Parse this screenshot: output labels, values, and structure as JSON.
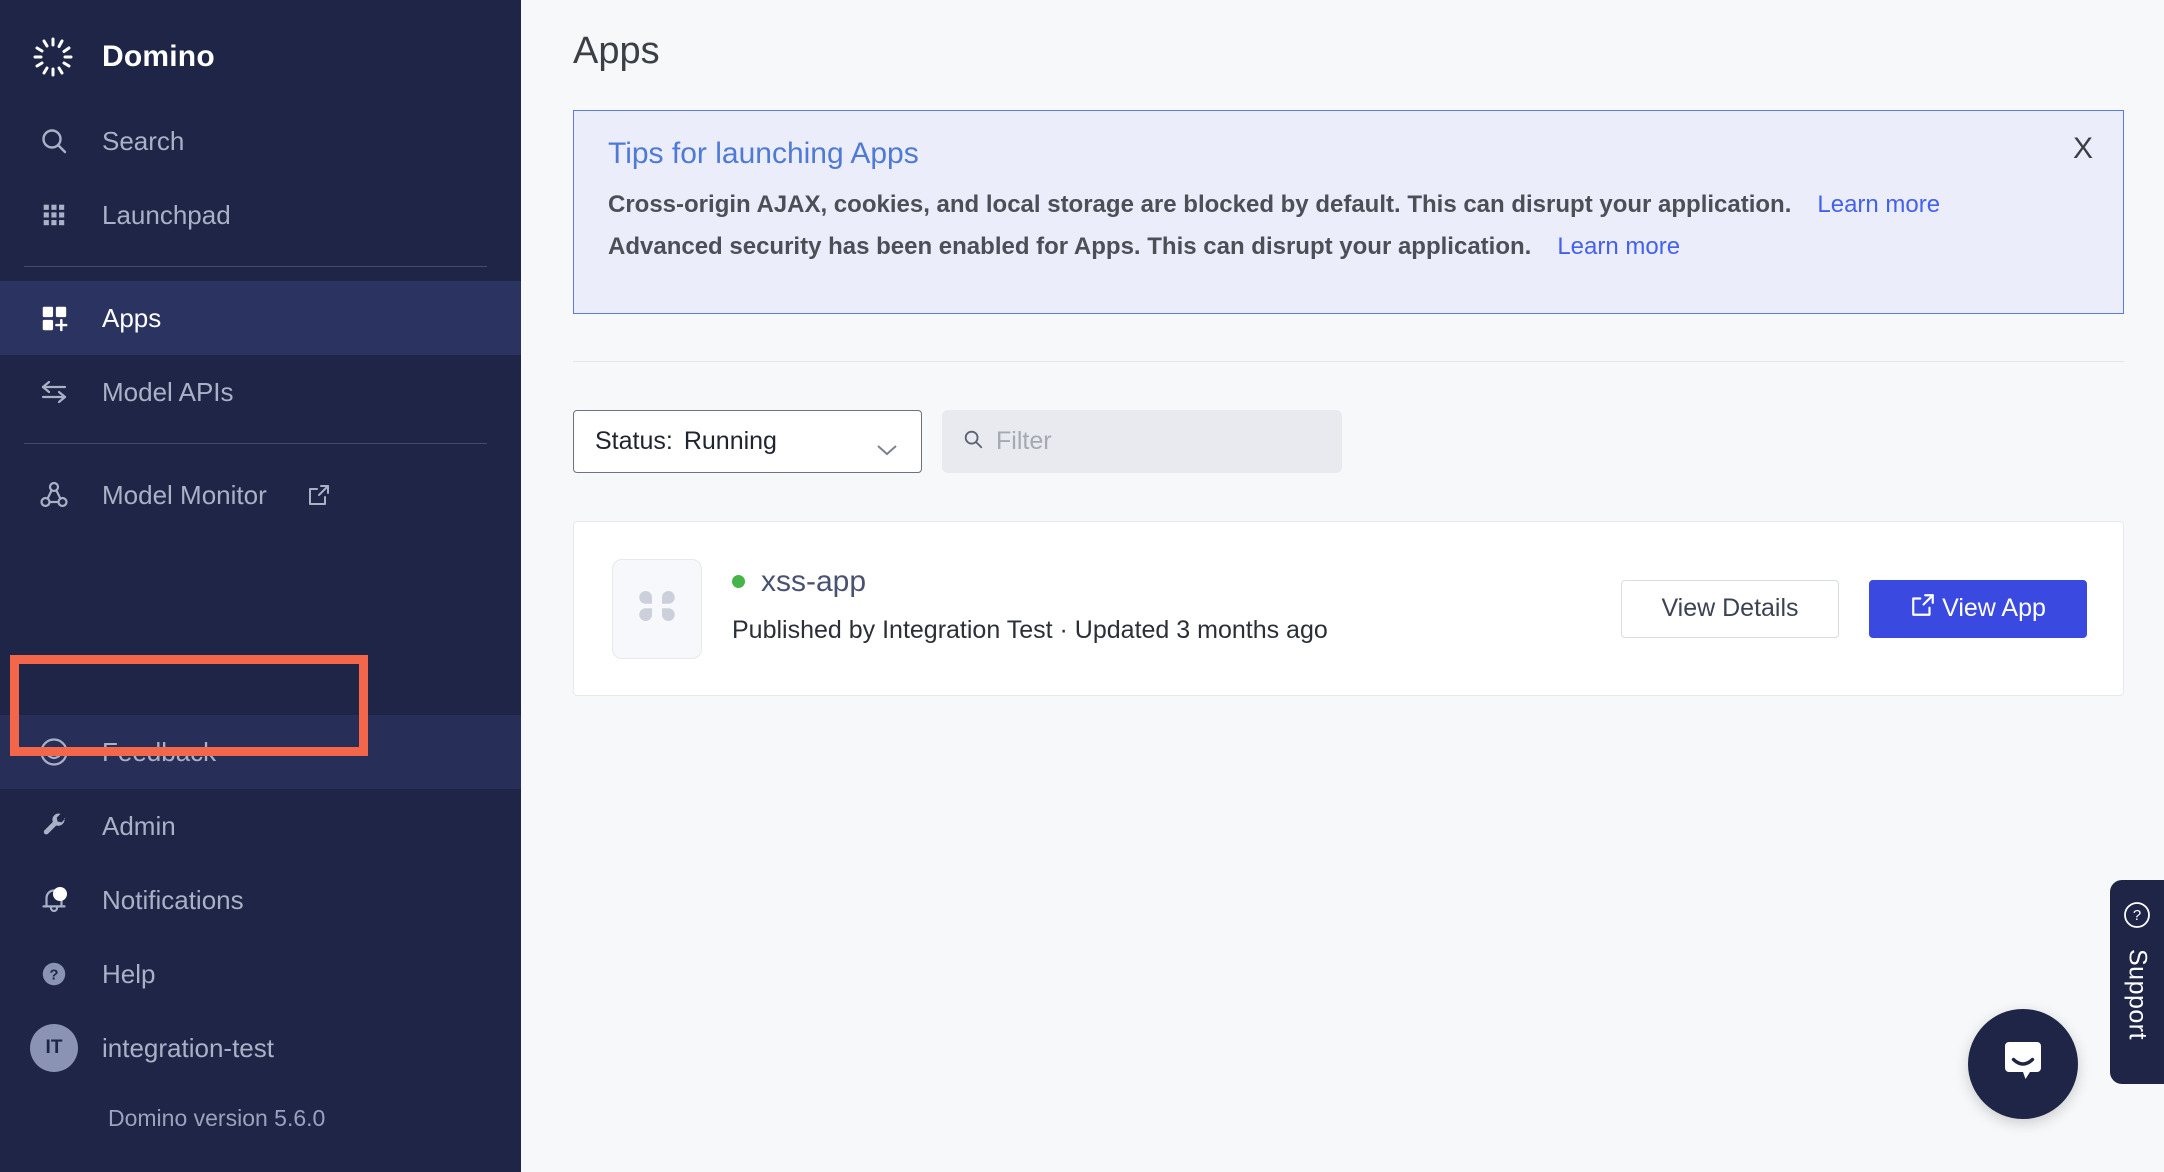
{
  "sidebar": {
    "brand": {
      "name": "Domino",
      "logo_icon": "domino-logo-icon"
    },
    "items": [
      {
        "label": "Search",
        "icon": "search-icon",
        "name": "search"
      },
      {
        "label": "Launchpad",
        "icon": "grid-icon",
        "name": "launchpad"
      },
      {
        "label": "Apps",
        "icon": "apps-add-icon",
        "name": "apps"
      },
      {
        "label": "Model APIs",
        "icon": "arrows-exchange-icon",
        "name": "model-apis"
      },
      {
        "label": "Model Monitor",
        "icon": "graph-nodes-icon",
        "name": "model-monitor",
        "external_icon": "external-link-icon"
      },
      {
        "label": "Feedback",
        "icon": "smiley-icon",
        "name": "feedback"
      },
      {
        "label": "Admin",
        "icon": "wrench-icon",
        "name": "admin"
      },
      {
        "label": "Notifications",
        "icon": "bell-icon",
        "name": "notifications"
      },
      {
        "label": "Help",
        "icon": "question-circle-icon",
        "name": "help"
      }
    ],
    "user": {
      "initials": "IT",
      "name": "integration-test"
    },
    "version": "Domino version 5.6.0",
    "highlight_color": "#f4664a",
    "active_bg": "#2b3360",
    "bg": "#1e2546"
  },
  "header": {
    "title": "Apps"
  },
  "banner": {
    "title": "Tips for launching Apps",
    "close_label": "X",
    "rows": [
      {
        "text": "Cross-origin AJAX, cookies, and local storage are blocked by default. This can disrupt your application.",
        "link": "Learn more"
      },
      {
        "text": "Advanced security has been enabled for Apps. This can disrupt your application.",
        "link": "Learn more"
      }
    ],
    "bg": "#ebedfb",
    "border": "#5b7ce0",
    "title_color": "#4e7ad6",
    "link_color": "#4361ee"
  },
  "filters": {
    "status": {
      "prefix": "Status:",
      "value": "Running",
      "chevron_icon": "chevron-down-icon"
    },
    "search": {
      "placeholder": "Filter",
      "value": "",
      "icon": "search-icon"
    }
  },
  "app_card": {
    "thumb_icon": "clover-app-icon",
    "status_dot_color": "#46b549",
    "title": "xss-app",
    "meta": "Published by Integration Test · Updated 3 months ago",
    "view_details_label": "View Details",
    "view_app_label": "View App",
    "view_app_icon": "external-link-icon",
    "primary_color": "#3a4ae0"
  },
  "support": {
    "label": "Support",
    "icon": "question-circle-icon",
    "chat_icon": "chat-bubble-icon"
  }
}
